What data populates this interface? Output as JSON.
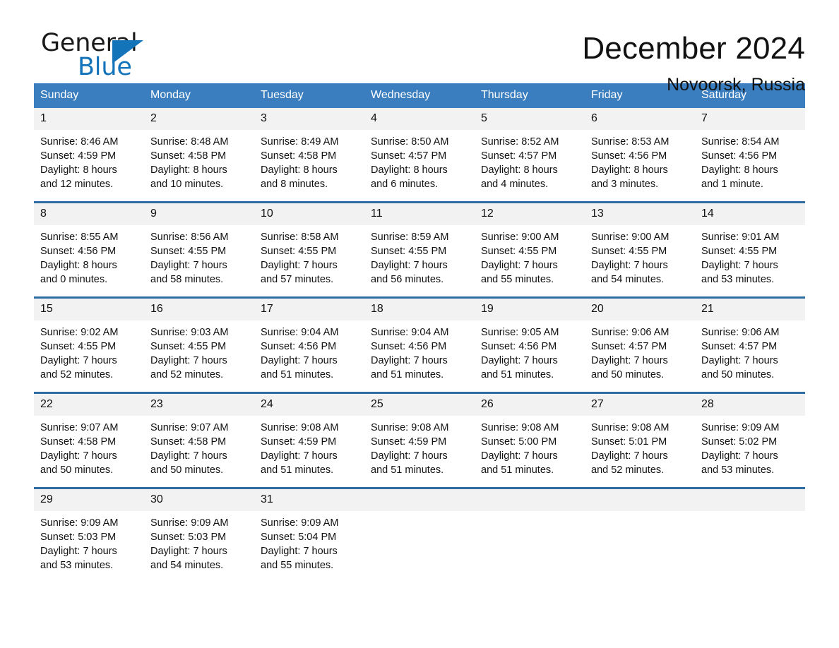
{
  "brand": {
    "name_part1": "General",
    "name_part2": "Blue",
    "triangle_icon": "triangle-icon",
    "accent_color": "#1474ba"
  },
  "header": {
    "title": "December 2024",
    "location": "Novoorsk, Russia"
  },
  "calendar": {
    "header_bg": "#3a7ebf",
    "row_divider_color": "#2e6da4",
    "daynum_bg": "#f2f2f2",
    "weekdays": [
      "Sunday",
      "Monday",
      "Tuesday",
      "Wednesday",
      "Thursday",
      "Friday",
      "Saturday"
    ],
    "weeks": [
      [
        {
          "day": "1",
          "sunrise": "Sunrise: 8:46 AM",
          "sunset": "Sunset: 4:59 PM",
          "daylight_line1": "Daylight: 8 hours",
          "daylight_line2": "and 12 minutes."
        },
        {
          "day": "2",
          "sunrise": "Sunrise: 8:48 AM",
          "sunset": "Sunset: 4:58 PM",
          "daylight_line1": "Daylight: 8 hours",
          "daylight_line2": "and 10 minutes."
        },
        {
          "day": "3",
          "sunrise": "Sunrise: 8:49 AM",
          "sunset": "Sunset: 4:58 PM",
          "daylight_line1": "Daylight: 8 hours",
          "daylight_line2": "and 8 minutes."
        },
        {
          "day": "4",
          "sunrise": "Sunrise: 8:50 AM",
          "sunset": "Sunset: 4:57 PM",
          "daylight_line1": "Daylight: 8 hours",
          "daylight_line2": "and 6 minutes."
        },
        {
          "day": "5",
          "sunrise": "Sunrise: 8:52 AM",
          "sunset": "Sunset: 4:57 PM",
          "daylight_line1": "Daylight: 8 hours",
          "daylight_line2": "and 4 minutes."
        },
        {
          "day": "6",
          "sunrise": "Sunrise: 8:53 AM",
          "sunset": "Sunset: 4:56 PM",
          "daylight_line1": "Daylight: 8 hours",
          "daylight_line2": "and 3 minutes."
        },
        {
          "day": "7",
          "sunrise": "Sunrise: 8:54 AM",
          "sunset": "Sunset: 4:56 PM",
          "daylight_line1": "Daylight: 8 hours",
          "daylight_line2": "and 1 minute."
        }
      ],
      [
        {
          "day": "8",
          "sunrise": "Sunrise: 8:55 AM",
          "sunset": "Sunset: 4:56 PM",
          "daylight_line1": "Daylight: 8 hours",
          "daylight_line2": "and 0 minutes."
        },
        {
          "day": "9",
          "sunrise": "Sunrise: 8:56 AM",
          "sunset": "Sunset: 4:55 PM",
          "daylight_line1": "Daylight: 7 hours",
          "daylight_line2": "and 58 minutes."
        },
        {
          "day": "10",
          "sunrise": "Sunrise: 8:58 AM",
          "sunset": "Sunset: 4:55 PM",
          "daylight_line1": "Daylight: 7 hours",
          "daylight_line2": "and 57 minutes."
        },
        {
          "day": "11",
          "sunrise": "Sunrise: 8:59 AM",
          "sunset": "Sunset: 4:55 PM",
          "daylight_line1": "Daylight: 7 hours",
          "daylight_line2": "and 56 minutes."
        },
        {
          "day": "12",
          "sunrise": "Sunrise: 9:00 AM",
          "sunset": "Sunset: 4:55 PM",
          "daylight_line1": "Daylight: 7 hours",
          "daylight_line2": "and 55 minutes."
        },
        {
          "day": "13",
          "sunrise": "Sunrise: 9:00 AM",
          "sunset": "Sunset: 4:55 PM",
          "daylight_line1": "Daylight: 7 hours",
          "daylight_line2": "and 54 minutes."
        },
        {
          "day": "14",
          "sunrise": "Sunrise: 9:01 AM",
          "sunset": "Sunset: 4:55 PM",
          "daylight_line1": "Daylight: 7 hours",
          "daylight_line2": "and 53 minutes."
        }
      ],
      [
        {
          "day": "15",
          "sunrise": "Sunrise: 9:02 AM",
          "sunset": "Sunset: 4:55 PM",
          "daylight_line1": "Daylight: 7 hours",
          "daylight_line2": "and 52 minutes."
        },
        {
          "day": "16",
          "sunrise": "Sunrise: 9:03 AM",
          "sunset": "Sunset: 4:55 PM",
          "daylight_line1": "Daylight: 7 hours",
          "daylight_line2": "and 52 minutes."
        },
        {
          "day": "17",
          "sunrise": "Sunrise: 9:04 AM",
          "sunset": "Sunset: 4:56 PM",
          "daylight_line1": "Daylight: 7 hours",
          "daylight_line2": "and 51 minutes."
        },
        {
          "day": "18",
          "sunrise": "Sunrise: 9:04 AM",
          "sunset": "Sunset: 4:56 PM",
          "daylight_line1": "Daylight: 7 hours",
          "daylight_line2": "and 51 minutes."
        },
        {
          "day": "19",
          "sunrise": "Sunrise: 9:05 AM",
          "sunset": "Sunset: 4:56 PM",
          "daylight_line1": "Daylight: 7 hours",
          "daylight_line2": "and 51 minutes."
        },
        {
          "day": "20",
          "sunrise": "Sunrise: 9:06 AM",
          "sunset": "Sunset: 4:57 PM",
          "daylight_line1": "Daylight: 7 hours",
          "daylight_line2": "and 50 minutes."
        },
        {
          "day": "21",
          "sunrise": "Sunrise: 9:06 AM",
          "sunset": "Sunset: 4:57 PM",
          "daylight_line1": "Daylight: 7 hours",
          "daylight_line2": "and 50 minutes."
        }
      ],
      [
        {
          "day": "22",
          "sunrise": "Sunrise: 9:07 AM",
          "sunset": "Sunset: 4:58 PM",
          "daylight_line1": "Daylight: 7 hours",
          "daylight_line2": "and 50 minutes."
        },
        {
          "day": "23",
          "sunrise": "Sunrise: 9:07 AM",
          "sunset": "Sunset: 4:58 PM",
          "daylight_line1": "Daylight: 7 hours",
          "daylight_line2": "and 50 minutes."
        },
        {
          "day": "24",
          "sunrise": "Sunrise: 9:08 AM",
          "sunset": "Sunset: 4:59 PM",
          "daylight_line1": "Daylight: 7 hours",
          "daylight_line2": "and 51 minutes."
        },
        {
          "day": "25",
          "sunrise": "Sunrise: 9:08 AM",
          "sunset": "Sunset: 4:59 PM",
          "daylight_line1": "Daylight: 7 hours",
          "daylight_line2": "and 51 minutes."
        },
        {
          "day": "26",
          "sunrise": "Sunrise: 9:08 AM",
          "sunset": "Sunset: 5:00 PM",
          "daylight_line1": "Daylight: 7 hours",
          "daylight_line2": "and 51 minutes."
        },
        {
          "day": "27",
          "sunrise": "Sunrise: 9:08 AM",
          "sunset": "Sunset: 5:01 PM",
          "daylight_line1": "Daylight: 7 hours",
          "daylight_line2": "and 52 minutes."
        },
        {
          "day": "28",
          "sunrise": "Sunrise: 9:09 AM",
          "sunset": "Sunset: 5:02 PM",
          "daylight_line1": "Daylight: 7 hours",
          "daylight_line2": "and 53 minutes."
        }
      ],
      [
        {
          "day": "29",
          "sunrise": "Sunrise: 9:09 AM",
          "sunset": "Sunset: 5:03 PM",
          "daylight_line1": "Daylight: 7 hours",
          "daylight_line2": "and 53 minutes."
        },
        {
          "day": "30",
          "sunrise": "Sunrise: 9:09 AM",
          "sunset": "Sunset: 5:03 PM",
          "daylight_line1": "Daylight: 7 hours",
          "daylight_line2": "and 54 minutes."
        },
        {
          "day": "31",
          "sunrise": "Sunrise: 9:09 AM",
          "sunset": "Sunset: 5:04 PM",
          "daylight_line1": "Daylight: 7 hours",
          "daylight_line2": "and 55 minutes."
        },
        {
          "day": "",
          "sunrise": "",
          "sunset": "",
          "daylight_line1": "",
          "daylight_line2": ""
        },
        {
          "day": "",
          "sunrise": "",
          "sunset": "",
          "daylight_line1": "",
          "daylight_line2": ""
        },
        {
          "day": "",
          "sunrise": "",
          "sunset": "",
          "daylight_line1": "",
          "daylight_line2": ""
        },
        {
          "day": "",
          "sunrise": "",
          "sunset": "",
          "daylight_line1": "",
          "daylight_line2": ""
        }
      ]
    ]
  }
}
